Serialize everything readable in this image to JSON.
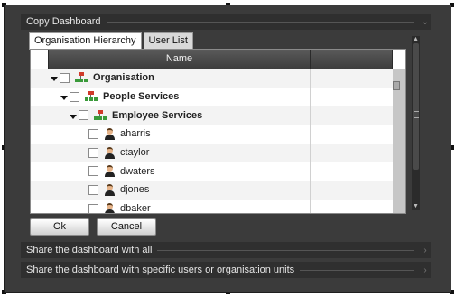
{
  "dialog": {
    "title": "Copy Dashboard"
  },
  "tabs": [
    {
      "label": "Organisation Hierarchy",
      "active": true
    },
    {
      "label": "User List",
      "active": false
    }
  ],
  "grid": {
    "column_header": "Name",
    "rows": [
      {
        "label": "Organisation",
        "type": "org",
        "level": 0,
        "expanded": true,
        "checked": false
      },
      {
        "label": "People Services",
        "type": "org",
        "level": 1,
        "expanded": true,
        "checked": false
      },
      {
        "label": "Employee Services",
        "type": "org",
        "level": 2,
        "expanded": true,
        "checked": false
      },
      {
        "label": "aharris",
        "type": "user",
        "level": 3,
        "checked": false
      },
      {
        "label": "ctaylor",
        "type": "user",
        "level": 3,
        "checked": false
      },
      {
        "label": "dwaters",
        "type": "user",
        "level": 3,
        "checked": false
      },
      {
        "label": "djones",
        "type": "user",
        "level": 3,
        "checked": false
      },
      {
        "label": "dbaker",
        "type": "user",
        "level": 3,
        "checked": false
      }
    ]
  },
  "buttons": {
    "ok": "Ok",
    "cancel": "Cancel"
  },
  "sections": {
    "share_all": "Share the dashboard with all",
    "share_specific": "Share the dashboard with specific users or organisation units"
  },
  "icons": {
    "collapse": "chevron-down-icon",
    "expand": "chevron-right-icon",
    "org": "org-chart-icon",
    "user": "user-icon"
  },
  "colors": {
    "dialog_bg": "#3b3b3b",
    "header_bg": "#2f2f2f",
    "grid_header_bg": "#4a4a4a",
    "org_icon_red": "#d03a2a",
    "org_icon_green": "#3a9a3a"
  }
}
